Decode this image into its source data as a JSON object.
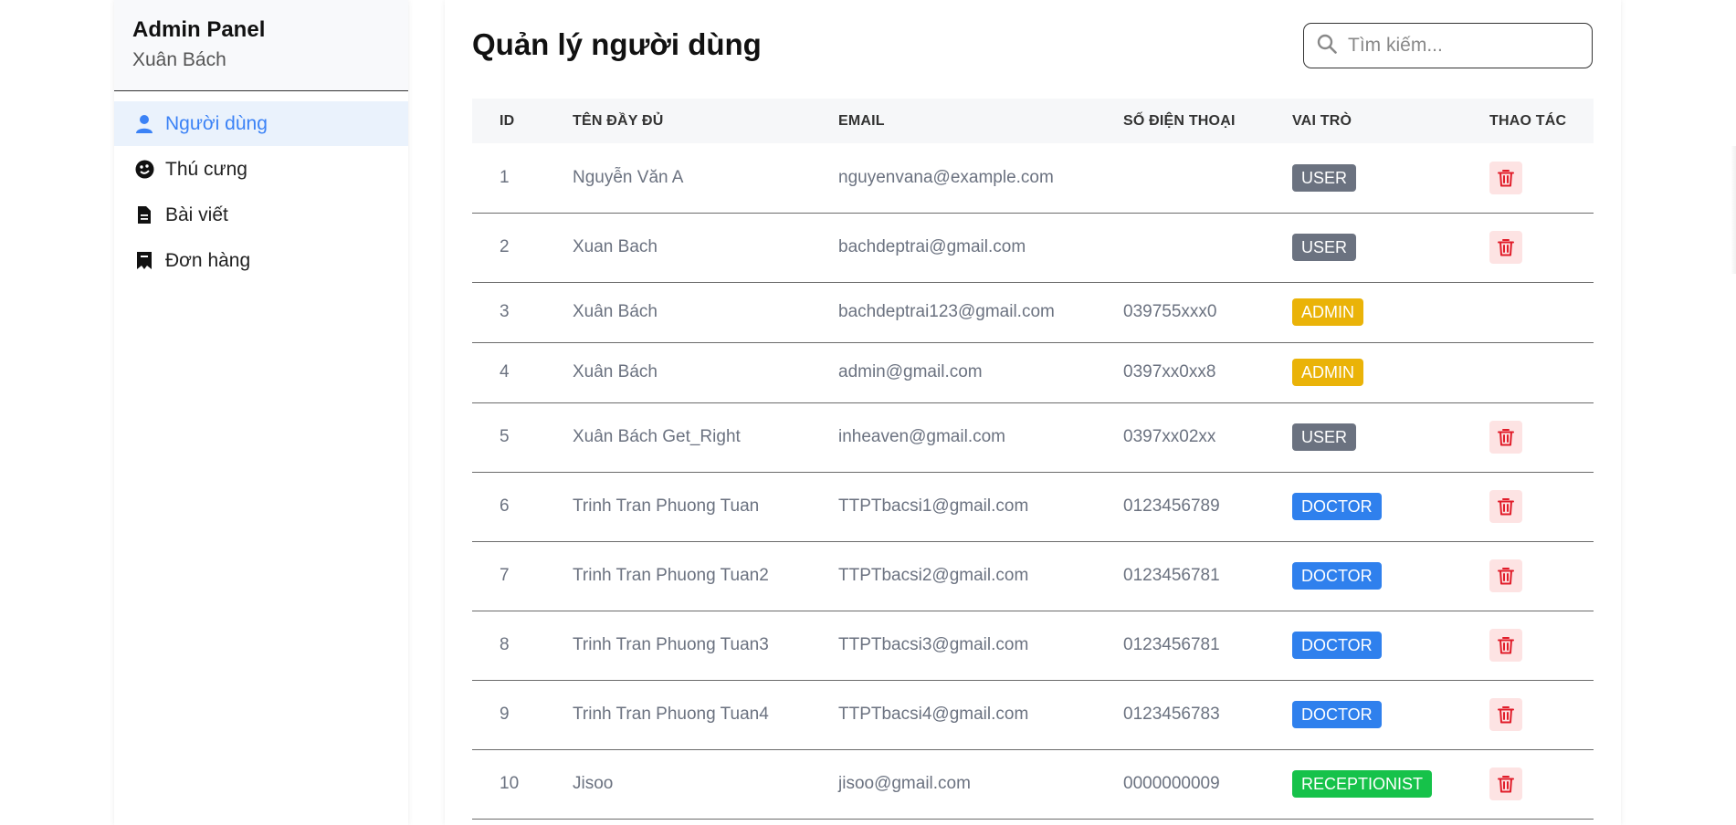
{
  "sidebar": {
    "title": "Admin Panel",
    "username": "Xuân Bách",
    "items": [
      {
        "label": "Người dùng",
        "icon": "user-icon",
        "active": true
      },
      {
        "label": "Thú cưng",
        "icon": "pet-icon",
        "active": false
      },
      {
        "label": "Bài viết",
        "icon": "document-icon",
        "active": false
      },
      {
        "label": "Đơn hàng",
        "icon": "order-icon",
        "active": false
      }
    ]
  },
  "main": {
    "title": "Quản lý người dùng",
    "search": {
      "placeholder": "Tìm kiếm...",
      "value": ""
    },
    "table": {
      "headers": {
        "id": "ID",
        "name": "TÊN ĐẦY ĐỦ",
        "email": "EMAIL",
        "phone": "SỐ ĐIỆN THOẠI",
        "role": "VAI TRÒ",
        "actions": "THAO TÁC"
      },
      "rows": [
        {
          "id": "1",
          "name": "Nguyễn Văn A",
          "email": "nguyenvana@example.com",
          "phone": "",
          "role": "USER",
          "deletable": true
        },
        {
          "id": "2",
          "name": "Xuan Bach",
          "email": "bachdeptrai@gmail.com",
          "phone": "",
          "role": "USER",
          "deletable": true
        },
        {
          "id": "3",
          "name": "Xuân Bách",
          "email": "bachdeptrai123@gmail.com",
          "phone": "039755xxx0",
          "role": "ADMIN",
          "deletable": false
        },
        {
          "id": "4",
          "name": "Xuân Bách",
          "email": "admin@gmail.com",
          "phone": "0397xx0xx8",
          "role": "ADMIN",
          "deletable": false
        },
        {
          "id": "5",
          "name": "Xuân Bách Get_Right",
          "email": "inheaven@gmail.com",
          "phone": "0397xx02xx",
          "role": "USER",
          "deletable": true
        },
        {
          "id": "6",
          "name": "Trinh Tran Phuong Tuan",
          "email": "TTPTbacsi1@gmail.com",
          "phone": "0123456789",
          "role": "DOCTOR",
          "deletable": true
        },
        {
          "id": "7",
          "name": "Trinh Tran Phuong Tuan2",
          "email": "TTPTbacsi2@gmail.com",
          "phone": "0123456781",
          "role": "DOCTOR",
          "deletable": true
        },
        {
          "id": "8",
          "name": "Trinh Tran Phuong Tuan3",
          "email": "TTPTbacsi3@gmail.com",
          "phone": "0123456781",
          "role": "DOCTOR",
          "deletable": true
        },
        {
          "id": "9",
          "name": "Trinh Tran Phuong Tuan4",
          "email": "TTPTbacsi4@gmail.com",
          "phone": "0123456783",
          "role": "DOCTOR",
          "deletable": true
        },
        {
          "id": "10",
          "name": "Jisoo",
          "email": "jisoo@gmail.com",
          "phone": "0000000009",
          "role": "RECEPTIONIST",
          "deletable": true
        }
      ]
    }
  },
  "colors": {
    "accent": "#3b82f6",
    "role_user": "#6b7280",
    "role_admin": "#eab308",
    "role_doctor": "#2f80ed",
    "role_receptionist": "#16c24a",
    "delete_icon": "#e11d2a",
    "delete_bg": "#fde3e3"
  }
}
